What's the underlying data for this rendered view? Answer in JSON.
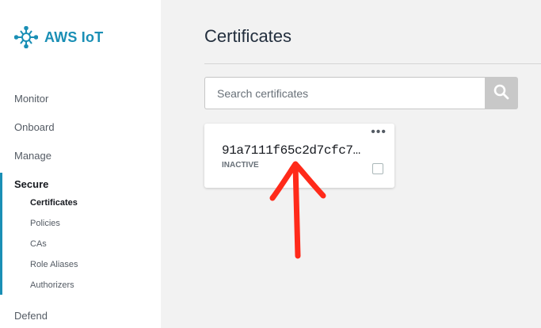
{
  "brand": {
    "name": "AWS IoT",
    "color": "#1a8fb5",
    "icon": "aws-iot-logo-icon"
  },
  "sidebar": {
    "items": [
      {
        "label": "Monitor",
        "active": false
      },
      {
        "label": "Onboard",
        "active": false
      },
      {
        "label": "Manage",
        "active": false
      },
      {
        "label": "Secure",
        "active": true
      },
      {
        "label": "Defend",
        "active": false
      }
    ],
    "secure_subitems": [
      {
        "label": "Certificates",
        "active": true
      },
      {
        "label": "Policies",
        "active": false
      },
      {
        "label": "CAs",
        "active": false
      },
      {
        "label": "Role Aliases",
        "active": false
      },
      {
        "label": "Authorizers",
        "active": false
      }
    ]
  },
  "main": {
    "title": "Certificates",
    "search": {
      "placeholder": "Search certificates",
      "value": "",
      "button_icon": "search-icon"
    },
    "certificates": [
      {
        "id": "91a7111f65c2d7cfc7…",
        "status": "INACTIVE",
        "menu_icon": "more-options-icon",
        "checked": false
      }
    ]
  },
  "annotation": {
    "type": "red-arrow",
    "color": "#ff2a1a",
    "points_to": "certificate-card"
  }
}
